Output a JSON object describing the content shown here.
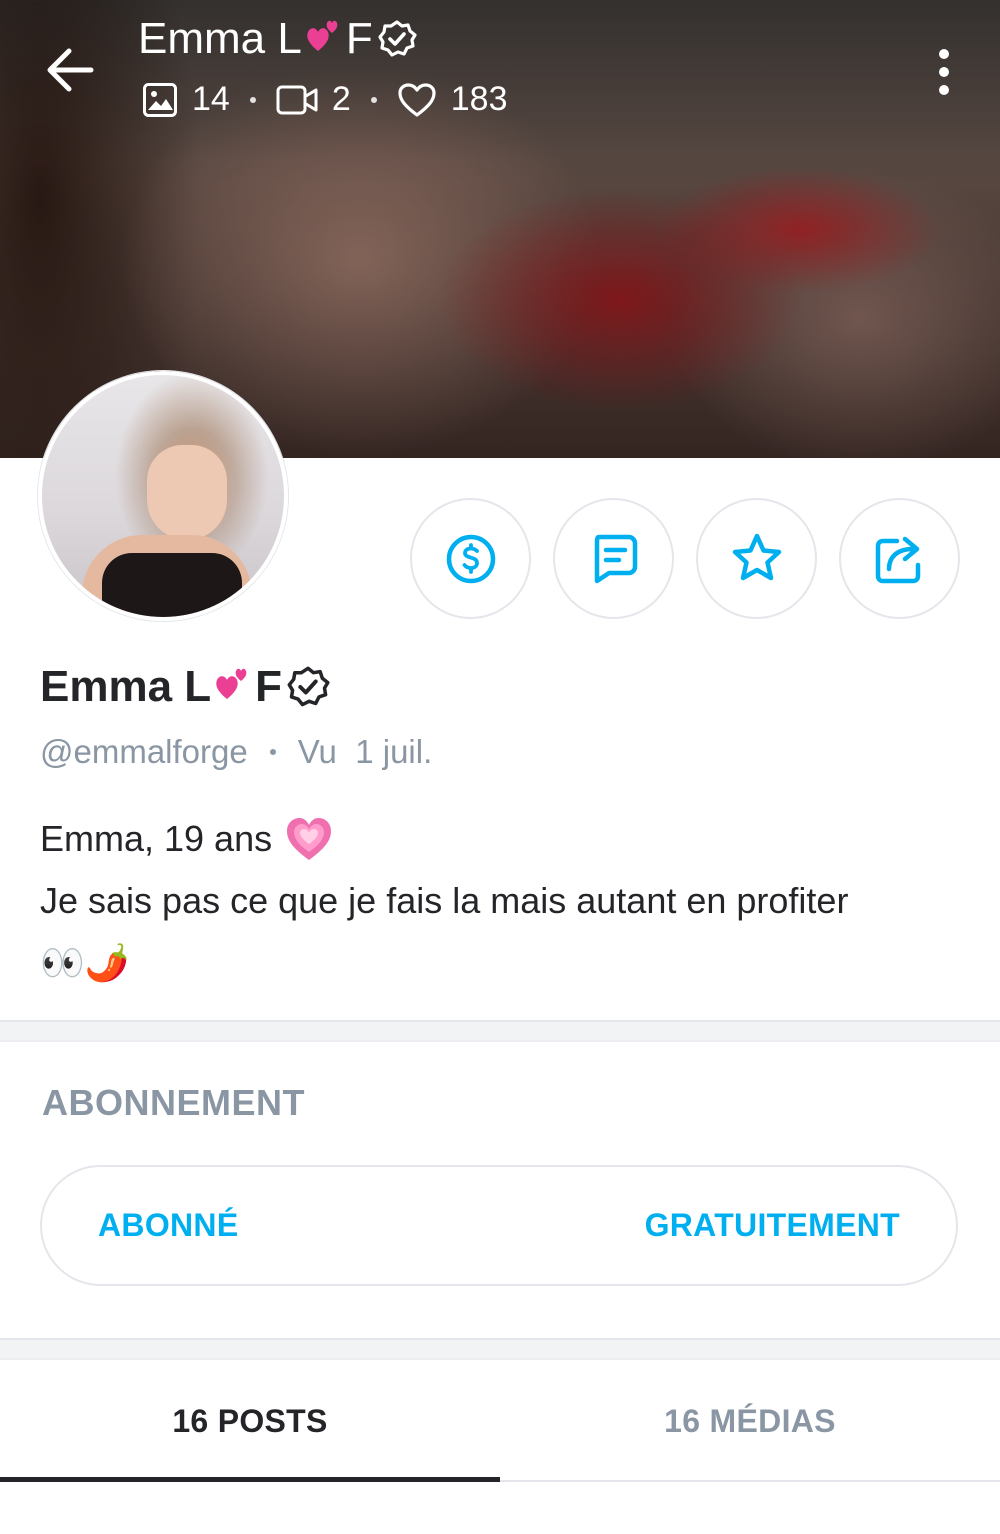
{
  "header": {
    "name_prefix": "Emma L",
    "name_suffix": "F",
    "photos_count": "14",
    "videos_count": "2",
    "likes_count": "183"
  },
  "profile": {
    "name_prefix": "Emma L",
    "name_suffix": "F",
    "handle": "@emmalforge",
    "last_seen": "Vu  1 juil.",
    "bio_line1": "Emma, 19 ans",
    "bio_line2": "Je sais pas ce que je fais la mais autant en profiter",
    "bio_line3_emoji": "👀🌶️"
  },
  "actions": {
    "tip_icon": "dollar-circle-icon",
    "message_icon": "message-icon",
    "favorite_icon": "star-icon",
    "share_icon": "share-icon"
  },
  "subscription": {
    "section_title": "ABONNEMENT",
    "status_label": "ABONNÉ",
    "price_label": "GRATUITEMENT"
  },
  "tabs": [
    {
      "label": "16 POSTS",
      "active": true
    },
    {
      "label": "16 MÉDIAS",
      "active": false
    }
  ],
  "colors": {
    "accent": "#00aff0",
    "text": "#242529",
    "muted": "#8a96a3",
    "border": "#e4e6eb"
  }
}
